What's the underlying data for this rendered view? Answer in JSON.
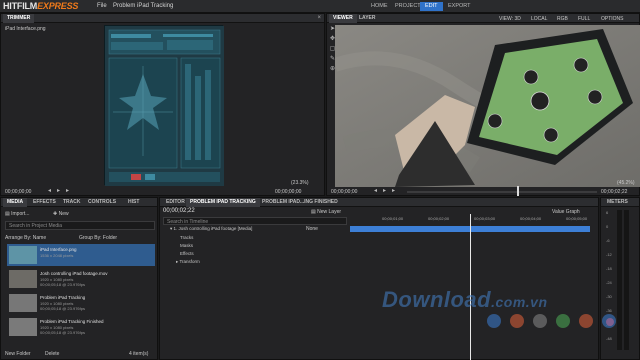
{
  "app": {
    "brand_main": "HITFILM",
    "brand_accent": "EXPRESS"
  },
  "menu": {
    "file": "File",
    "project": "Problem iPad Tracking"
  },
  "nav_tabs": [
    "HOME",
    "PROJECT",
    "EDIT",
    "EXPORT"
  ],
  "nav_active": "EDIT",
  "trimmer": {
    "tab": "TRIMMER",
    "file": "iPad Interface.png",
    "time_left": "00;00;00;00",
    "zoom": "(23.3%)",
    "time_right": "00;00;00;00"
  },
  "viewer": {
    "tabs": [
      "VIEWER",
      "LAYER"
    ],
    "view_label": "VIEW: 3D",
    "local_label": "LOCAL",
    "rgb_label": "RGB",
    "full_label": "FULL",
    "options_label": "OPTIONS",
    "time_left": "00;00;00;00",
    "zoom": "(45.2%)",
    "time_right": "00;00;02;22"
  },
  "media": {
    "tabs": [
      "MEDIA",
      "EFFECTS",
      "TRACK",
      "CONTROLS",
      "HIST"
    ],
    "import_label": "Import...",
    "new_label": "New",
    "search_placeholder": "Search in Project Media",
    "arrange_label": "Arrange By: Name",
    "group_label": "Group By: Folder",
    "items": [
      {
        "name": "iPad Interface.png",
        "l2": "1536 x 2048 pixels",
        "l3": ""
      },
      {
        "name": "Josh controlling iPad footage.mov",
        "l2": "1920 x 1080 pixels",
        "l3": "00;00;05;18 @ 23.976fps"
      },
      {
        "name": "Problem iPad Tracking",
        "l2": "1920 x 1080 pixels",
        "l3": "00;00;05;18 @ 23.976fps"
      },
      {
        "name": "Problem iPad Tracking Finished",
        "l2": "1920 x 1080 pixels",
        "l3": "00;00;05;18 @ 23.976fps"
      }
    ],
    "new_folder_label": "New Folder",
    "delete_label": "Delete",
    "count_label": "4 item(s)"
  },
  "timeline": {
    "tabs": [
      "EDITOR",
      "PROBLEM IPAD TRACKING",
      "PROBLEM IPAD...ING FINISHED"
    ],
    "timecode": "00;00;02;22",
    "new_layer_label": "New Layer",
    "search_placeholder": "Search in Timeline",
    "value_graph_label": "Value Graph",
    "ruler": [
      "00;00;01;00",
      "00;00;02;00",
      "00;00;03;00",
      "00;00;04;00",
      "00;00;05;00"
    ],
    "layer_name": "1. Josh controlling iPad footage [Media]",
    "blend_label": "None",
    "props": [
      "Tracks",
      "Masks",
      "Effects",
      "Transform"
    ]
  },
  "meters": {
    "title": "METERS",
    "labels": [
      "6",
      "0",
      "-6",
      "-12",
      "-18",
      "-24",
      "-30",
      "-36",
      "-42",
      "-48"
    ]
  },
  "watermark": {
    "text": "Download",
    "domain": ".com.vn"
  },
  "colors": {
    "accent_blue": "#2f72c9",
    "brand_orange": "#f07a1a",
    "track_bar": "#3d7fd6",
    "tablet_green": "#7aae69"
  },
  "watermark_dots": [
    "#3d7fd6",
    "#e3623a",
    "#8a8a8a",
    "#4fae58",
    "#e3623a",
    "#3d7fd6"
  ]
}
